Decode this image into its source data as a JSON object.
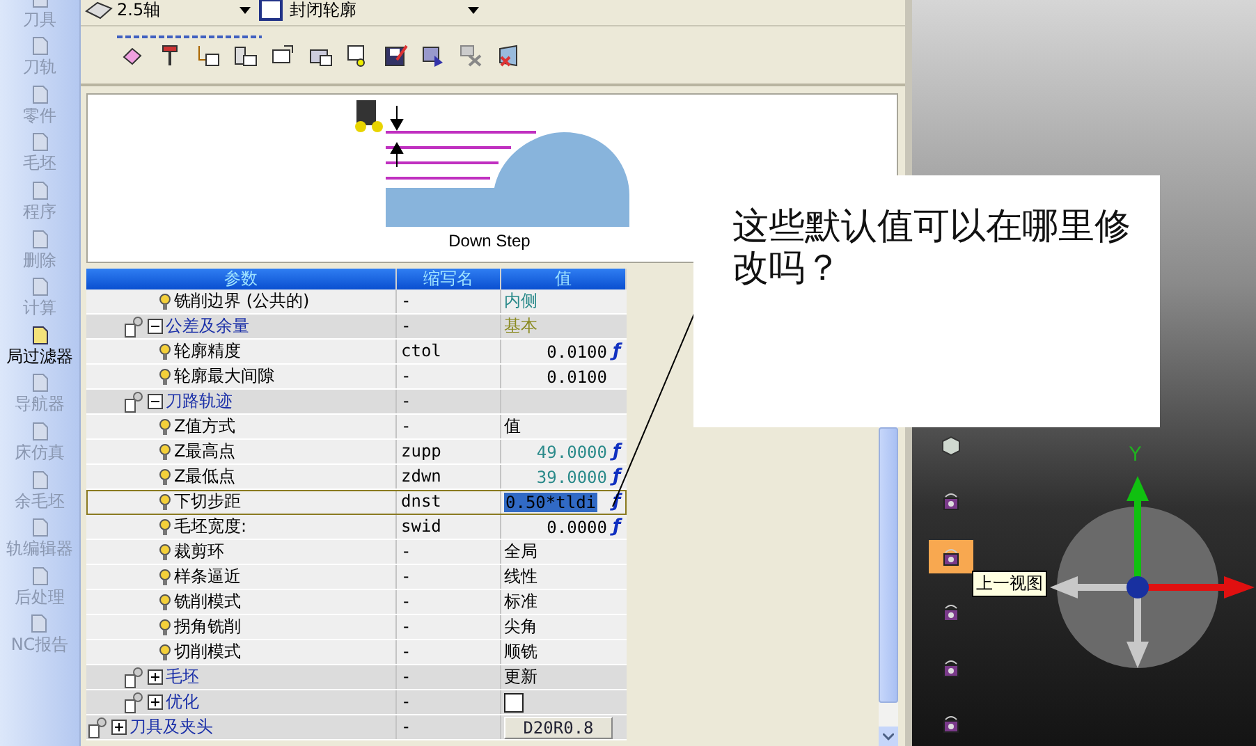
{
  "sidebar": {
    "items": [
      {
        "label": "刀具",
        "selected": false
      },
      {
        "label": "刀轨",
        "selected": false
      },
      {
        "label": "零件",
        "selected": false
      },
      {
        "label": "毛坯",
        "selected": false
      },
      {
        "label": "程序",
        "selected": false
      },
      {
        "label": "删除",
        "selected": false
      },
      {
        "label": "计算",
        "selected": false
      },
      {
        "label": "局过滤器",
        "selected": true
      },
      {
        "label": "导航器",
        "selected": false
      },
      {
        "label": "床仿真",
        "selected": false
      },
      {
        "label": "余毛坯",
        "selected": false
      },
      {
        "label": "轨编辑器",
        "selected": false
      },
      {
        "label": "后处理",
        "selected": false
      },
      {
        "label": "NC报告",
        "selected": false
      }
    ]
  },
  "toolbar": {
    "combos": [
      {
        "value": "2.5轴"
      },
      {
        "value": "封闭轮廓"
      }
    ]
  },
  "preview": {
    "caption": "Down Step"
  },
  "table": {
    "columns": [
      "参数",
      "缩写名",
      "值"
    ],
    "rows": [
      {
        "children": [
          {
            "children": [
              {
                "kind": "param",
                "name": "铣削边界 (公共的)",
                "abbr": "-",
                "value": {
                  "kind": "text",
                  "text": "内侧",
                  "color": "#2a8a8a"
                },
                "selected": false
              }
            ]
          },
          {
            "kind": "group",
            "name": "公差及余量",
            "abbr": "-",
            "value": {
              "kind": "text",
              "text": "基本",
              "color": "#8a8a20"
            },
            "expanded": true,
            "children": [
              {
                "kind": "param",
                "name": "轮廓精度",
                "abbr": "ctol",
                "value": {
                  "kind": "number",
                  "text": "0.0100",
                  "color": "#000000"
                },
                "mark": "ƒ",
                "selected": false
              },
              {
                "kind": "param",
                "name": "轮廓最大间隙",
                "abbr": "-",
                "value": {
                  "kind": "number",
                  "text": "0.0100",
                  "color": "#000000"
                },
                "selected": false
              }
            ]
          },
          {
            "kind": "group",
            "name": "刀路轨迹",
            "abbr": "-",
            "expanded": true,
            "children": [
              {
                "kind": "param",
                "name": "Z值方式",
                "abbr": "-",
                "value": {
                  "kind": "text",
                  "text": "值",
                  "color": "#000000"
                },
                "selected": false
              },
              {
                "kind": "param",
                "name": "Z最高点",
                "abbr": "zupp",
                "value": {
                  "kind": "number",
                  "text": "49.0000",
                  "color": "#2a8a8a"
                },
                "mark": "ƒ",
                "selected": false
              },
              {
                "kind": "param",
                "name": "Z最低点",
                "abbr": "zdwn",
                "value": {
                  "kind": "number",
                  "text": "39.0000",
                  "color": "#2a8a8a"
                },
                "mark": "ƒ",
                "selected": false
              },
              {
                "kind": "param",
                "name": "下切步距",
                "abbr": "dnst",
                "value": {
                  "kind": "edit",
                  "text": "0.50*tldi"
                },
                "mark": "ƒ",
                "selected": true
              },
              {
                "kind": "param",
                "name": "毛坯宽度:",
                "abbr": "swid",
                "value": {
                  "kind": "number",
                  "text": "0.0000",
                  "color": "#000000"
                },
                "mark": "ƒ",
                "selected": false
              },
              {
                "kind": "param",
                "name": "裁剪环",
                "abbr": "-",
                "value": {
                  "kind": "text",
                  "text": "全局",
                  "color": "#000000"
                },
                "selected": false
              },
              {
                "kind": "param",
                "name": "样条逼近",
                "abbr": "-",
                "value": {
                  "kind": "text",
                  "text": "线性",
                  "color": "#000000"
                },
                "selected": false
              },
              {
                "kind": "param",
                "name": "铣削模式",
                "abbr": "-",
                "value": {
                  "kind": "text",
                  "text": "标准",
                  "color": "#000000"
                },
                "selected": false
              },
              {
                "kind": "param",
                "name": "拐角铣削",
                "abbr": "-",
                "value": {
                  "kind": "text",
                  "text": "尖角",
                  "color": "#000000"
                },
                "selected": false
              },
              {
                "kind": "param",
                "name": "切削模式",
                "abbr": "-",
                "value": {
                  "kind": "text",
                  "text": "顺铣",
                  "color": "#000000"
                },
                "selected": false
              }
            ]
          },
          {
            "kind": "group",
            "name": "毛坯",
            "abbr": "-",
            "value": {
              "kind": "text",
              "text": "更新",
              "color": "#000000"
            },
            "expanded": false
          },
          {
            "kind": "group",
            "name": "优化",
            "abbr": "-",
            "value": {
              "kind": "checkbox",
              "checked": false
            },
            "expanded": false
          }
        ]
      },
      {
        "kind": "group",
        "name": "刀具及夹头",
        "abbr": "-",
        "value": {
          "kind": "button",
          "text": "D20R0.8"
        },
        "expanded": false
      }
    ]
  },
  "callout": {
    "text": "这些默认值可以在哪里修改吗？"
  },
  "viewport": {
    "tools": [
      {
        "selected": false
      },
      {
        "selected": false
      },
      {
        "selected": true
      },
      {
        "selected": false
      },
      {
        "selected": false
      },
      {
        "selected": false
      }
    ],
    "tooltip": "上一视图",
    "axis_label": "Y"
  }
}
